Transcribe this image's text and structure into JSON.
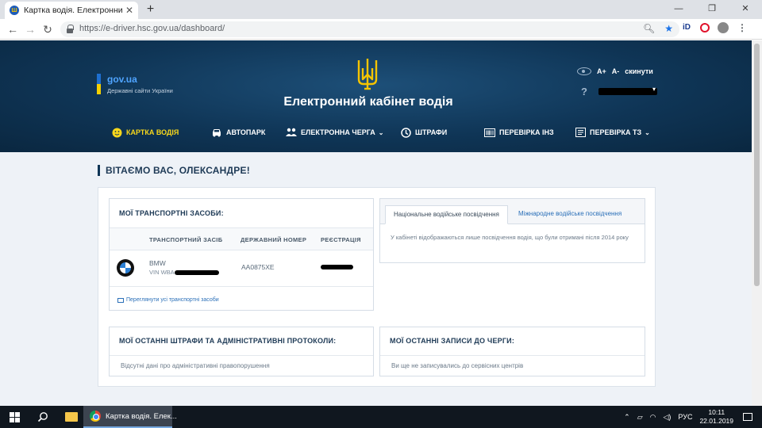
{
  "browser": {
    "tab_title": "Картка водія. Електронний кабінет водія",
    "url": "https://e-driver.hsc.gov.ua/dashboard/"
  },
  "header": {
    "gov_name": "gov.ua",
    "gov_sub": "Державні сайти України",
    "site_title": "Електронний кабінет водія",
    "font_plus": "A+",
    "font_minus": "A-",
    "reset": "скинути",
    "help": "?"
  },
  "nav": [
    {
      "label": "КАРТКА ВОДІЯ",
      "icon": "face-icon",
      "active": true
    },
    {
      "label": "АВТОПАРК",
      "icon": "car-icon"
    },
    {
      "label": "ЕЛЕКТРОННА ЧЕРГА",
      "icon": "queue-icon",
      "dropdown": true
    },
    {
      "label": "ШТРАФИ",
      "icon": "fines-icon"
    },
    {
      "label": "ПЕРЕВІРКА ІНЗ",
      "icon": "barcode-icon"
    },
    {
      "label": "ПЕРЕВІРКА ТЗ",
      "icon": "document-icon",
      "dropdown": true
    }
  ],
  "greeting": "ВІТАЄМО ВАС, ОЛЕКСАНДРЕ!",
  "vehicles": {
    "title": "МОЇ ТРАНСПОРТНІ ЗАСОБИ:",
    "columns": [
      "ТРАНСПОРТНИЙ ЗАСІБ",
      "ДЕРЖАВНИЙ НОМЕР",
      "РЕЄСТРАЦІЯ"
    ],
    "rows": [
      {
        "make": "BMW",
        "vin_prefix": "VIN WBA",
        "plate": "AA0875XE"
      }
    ],
    "view_all": "Переглянути усі транспортні засоби"
  },
  "licenses": {
    "tab_national": "Національне водійське посвідчення",
    "tab_international": "Міжнародне водійське посвідчення",
    "text": "У кабінеті відображаються лише посвідчення водія, що були отримані після 2014 року"
  },
  "fines": {
    "title": "МОЇ ОСТАННІ ШТРАФИ ТА АДМІНІСТРАТИВНІ ПРОТОКОЛИ:",
    "empty": "Відсутні дані про адміністративні правопорушення"
  },
  "queue": {
    "title": "МОЇ ОСТАННІ ЗАПИСИ ДО ЧЕРГИ:",
    "empty": "Ви ще не записувались до сервісних центрів"
  },
  "taskbar": {
    "app_label": "Картка водія. Елек...",
    "lang": "РУС",
    "time": "10:11",
    "date": "22.01.2019"
  },
  "colors": {
    "header_bg": "#0f3556",
    "active_nav": "#f7d71c",
    "link": "#2a6fb8",
    "gov_blue": "#1e6fd0",
    "gov_yellow": "#f5d000"
  }
}
